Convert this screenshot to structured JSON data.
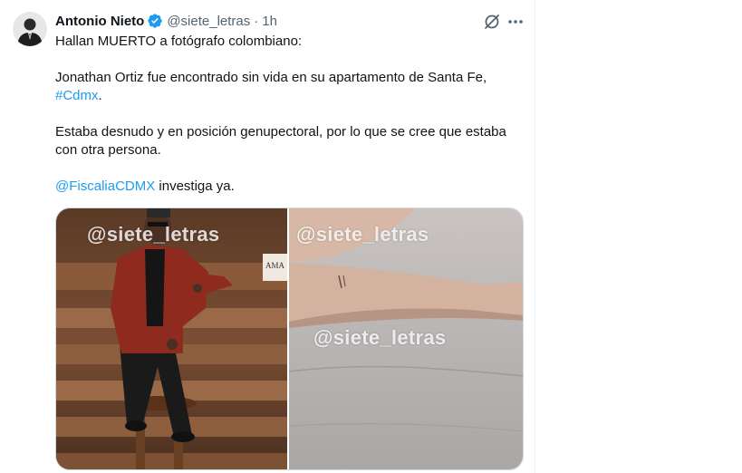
{
  "tweet": {
    "display_name": "Antonio Nieto",
    "handle": "@siete_letras",
    "separator": "·",
    "time": "1h",
    "paragraphs": {
      "p1": "Hallan MUERTO a fotógrafo colombiano:",
      "p2_text": " Jonathan Ortiz fue encontrado sin vida en su apartamento de Santa Fe,",
      "p2_hashtag": "#Cdmx",
      "p2_end": ".",
      "p3": "Estaba desnudo y en posición genupectoral, por lo que se cree que estaba con otra persona.",
      "p4_mention": "@FiscaliaCDMX",
      "p4_text": " investiga ya."
    },
    "media": {
      "watermark_1": "@siete_letras",
      "watermark_2": "@siete_letras",
      "watermark_3": "@siete_letras",
      "sign_text": "AMA"
    }
  },
  "icons": {
    "verified": "verified-badge-icon",
    "grok": "grok-icon",
    "more": "more-options-icon"
  },
  "colors": {
    "link": "#1d9bf0",
    "secondary_text": "#536471",
    "verified": "#1d9bf0"
  }
}
